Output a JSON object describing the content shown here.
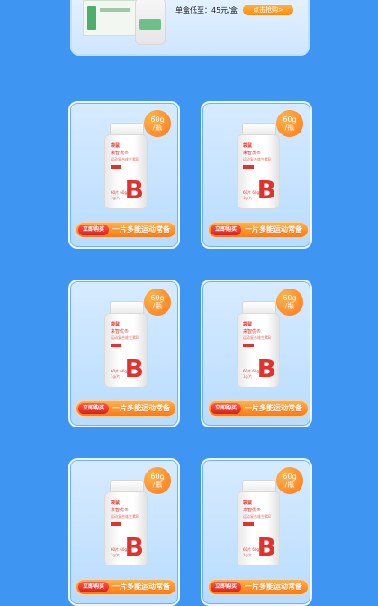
{
  "promo": {
    "price_text": "单盒低至：45元/盒",
    "button_label": "点击抢购>"
  },
  "product": {
    "badge_weight": "60g",
    "badge_unit": "/瓶",
    "brand": "袋鼠",
    "name": "来智优®",
    "sub": "运动复合维生素B",
    "letter": "B",
    "spec1": "60片 60g",
    "spec2": "1g/片",
    "buy_label": "立即购买",
    "slogan": "一片多能运动常备"
  }
}
